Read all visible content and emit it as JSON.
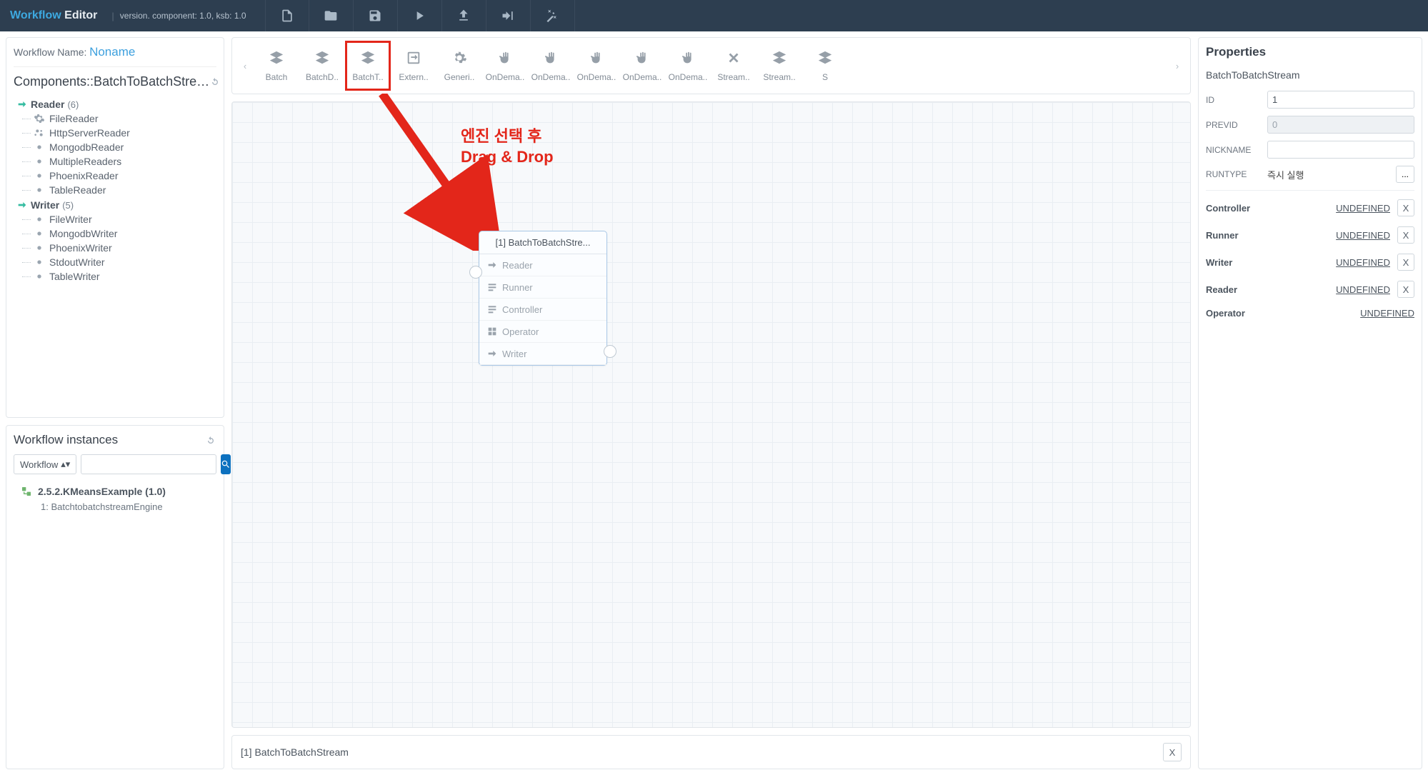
{
  "topbar": {
    "title_wf": "Workflow",
    "title_ed": "Editor",
    "version": "version. component: 1.0, ksb: 1.0"
  },
  "left": {
    "workflow_name_label": "Workflow Name:",
    "workflow_name_value": "Noname",
    "components_header": "Components::BatchToBatchStre…",
    "reader_group": "Reader",
    "reader_count": "(6)",
    "reader_items": [
      "FileReader",
      "HttpServerReader",
      "MongodbReader",
      "MultipleReaders",
      "PhoenixReader",
      "TableReader"
    ],
    "writer_group": "Writer",
    "writer_count": "(5)",
    "writer_items": [
      "FileWriter",
      "MongodbWriter",
      "PhoenixWriter",
      "StdoutWriter",
      "TableWriter"
    ]
  },
  "instances": {
    "title": "Workflow instances",
    "select": "Workflow",
    "example": "2.5.2.KMeansExample (1.0)",
    "example_sub": "1: BatchtobatchstreamEngine"
  },
  "engines": [
    "Batch",
    "BatchD..",
    "BatchT..",
    "Extern..",
    "Generi..",
    "OnDema..",
    "OnDema..",
    "OnDema..",
    "OnDema..",
    "OnDema..",
    "Stream..",
    "Stream..",
    "S"
  ],
  "annotation": {
    "line1": "엔진 선택 후",
    "line2": "Drag & Drop"
  },
  "node": {
    "title": "[1] BatchToBatchStre...",
    "slots": [
      "Reader",
      "Runner",
      "Controller",
      "Operator",
      "Writer"
    ]
  },
  "breadcrumb": {
    "text": "[1] BatchToBatchStream",
    "close": "X"
  },
  "props": {
    "title": "Properties",
    "subtitle": "BatchToBatchStream",
    "id_label": "ID",
    "id_value": "1",
    "previd_label": "PREVID",
    "previd_value": "0",
    "nickname_label": "NICKNAME",
    "nickname_value": "",
    "runtype_label": "RUNTYPE",
    "runtype_value": "즉시 실행",
    "sections": [
      {
        "label": "Controller",
        "value": "UNDEFINED",
        "x": true
      },
      {
        "label": "Runner",
        "value": "UNDEFINED",
        "x": true
      },
      {
        "label": "Writer",
        "value": "UNDEFINED",
        "x": true
      },
      {
        "label": "Reader",
        "value": "UNDEFINED",
        "x": true
      },
      {
        "label": "Operator",
        "value": "UNDEFINED",
        "x": false
      }
    ],
    "ellipsis": "...",
    "x": "X"
  }
}
